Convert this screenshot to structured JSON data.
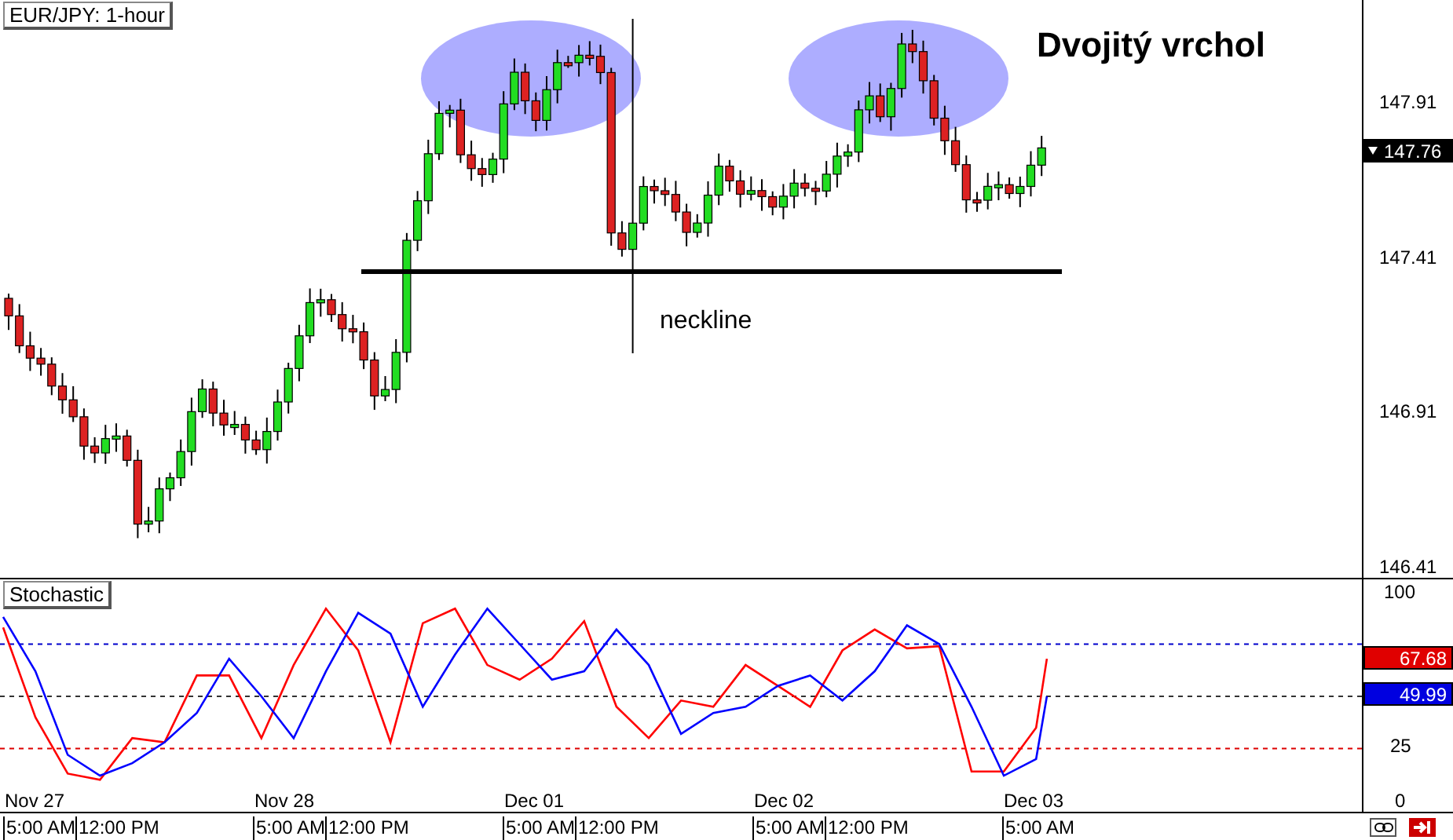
{
  "chart_label": "EUR/JPY: 1-hour",
  "annotation_title": "Dvojitý vrchol",
  "annotation_neckline": "neckline",
  "price_axis": {
    "ticks": [
      "147.91",
      "147.41",
      "146.91",
      "146.41"
    ],
    "current_price": "147.76"
  },
  "stochastic": {
    "label": "Stochastic",
    "axis_labels": [
      "100",
      "25",
      "0"
    ],
    "readings": [
      {
        "text": "67.68",
        "color": "#e00000"
      },
      {
        "text": "49.99",
        "color": "#0000e0"
      }
    ]
  },
  "time_axis": {
    "days": [
      {
        "date": "Nov 27",
        "times": [
          "5:00 AM",
          "12:00 PM"
        ]
      },
      {
        "date": "Nov 28",
        "times": [
          "5:00 AM",
          "12:00 PM"
        ]
      },
      {
        "date": "Dec 01",
        "times": [
          "5:00 AM",
          "12:00 PM"
        ]
      },
      {
        "date": "Dec 02",
        "times": [
          "5:00 AM",
          "12:00 PM"
        ]
      },
      {
        "date": "Dec 03",
        "times": [
          "5:00 AM"
        ]
      }
    ]
  }
}
